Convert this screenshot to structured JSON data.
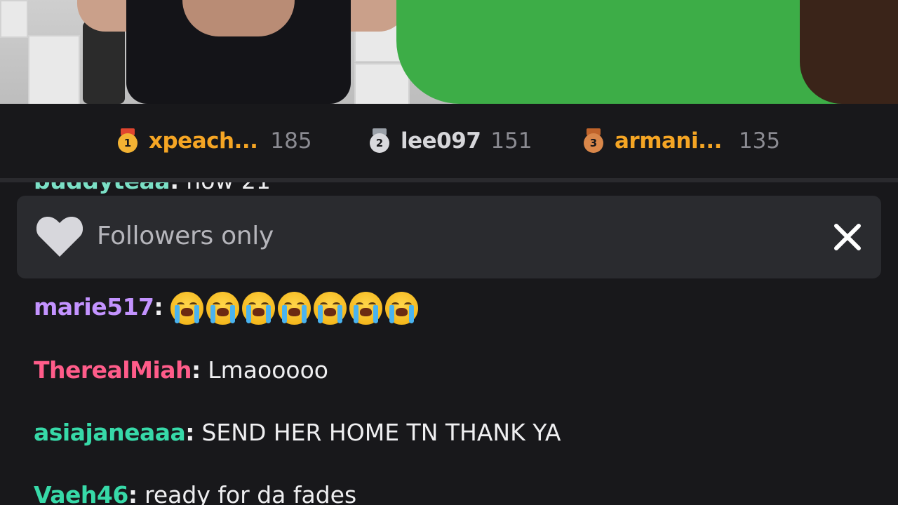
{
  "leaderboard": [
    {
      "rank": "1",
      "name": "xpeach...",
      "count": "185",
      "name_color": "#f5a524",
      "medal_color": "#f2b233",
      "ribbon_color": "#e0452f"
    },
    {
      "rank": "2",
      "name": "lee097",
      "count": "151",
      "name_color": "#d6d6da",
      "medal_color": "#d9d9dd",
      "ribbon_color": "#9aa0a8"
    },
    {
      "rank": "3",
      "name": "armani...",
      "count": "135",
      "name_color": "#f5a524",
      "medal_color": "#d9874a",
      "ribbon_color": "#c0642b"
    }
  ],
  "chat": {
    "partial_message": {
      "user": "buddyteaa",
      "text": "now 21",
      "user_color": "#7be0c6"
    },
    "messages": [
      {
        "user": "marie517",
        "text": "",
        "emoji": "loudly-crying-face",
        "emoji_count": 7,
        "user_color": "#c393ff"
      },
      {
        "user": "TherealMiah",
        "text": "Lmaooooo",
        "user_color": "#ff5c8a"
      },
      {
        "user": "asiajaneaaa",
        "text": "SEND HER HOME TN THANK YA",
        "user_color": "#37d9a8"
      },
      {
        "user": "Vaeh46",
        "text": "ready for da fades",
        "user_color": "#37d9a8"
      }
    ]
  },
  "banner": {
    "label": "Followers only",
    "icon": "heart-icon",
    "close_icon": "close-icon"
  },
  "colors": {
    "background": "#18181b",
    "banner_bg": "#2a2b2f",
    "count_gray": "#8b8b92"
  }
}
